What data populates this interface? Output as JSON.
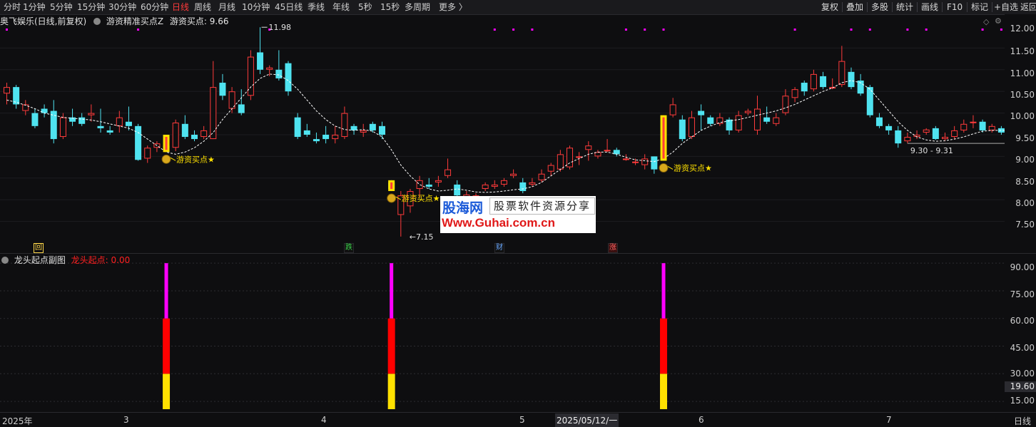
{
  "toolbar": {
    "periods": [
      "分时",
      "1分钟",
      "5分钟",
      "15分钟",
      "30分钟",
      "60分钟",
      "日线",
      "周线",
      "月线",
      "10分钟",
      "45日线",
      "季线",
      "年线",
      "5秒",
      "15秒",
      "多周期",
      "更多 〉"
    ],
    "active_period": "日线",
    "right_tools": [
      "复权",
      "叠加",
      "多股",
      "统计",
      "画线",
      "F10",
      "标记",
      "+自选",
      "返回"
    ]
  },
  "main_legend": {
    "stock": "奥飞娱乐(日线,前复权)",
    "indicator_name": "游资精准买点Z",
    "indicator_value": "游资买点: 9.66"
  },
  "sub_legend": {
    "indicator_name": "龙头起点副图",
    "indicator_value": "龙头起点: 0.00"
  },
  "price_axis": [
    "12.00",
    "11.50",
    "11.00",
    "10.50",
    "10.00",
    "9.50",
    "9.00",
    "8.50",
    "8.00",
    "7.50"
  ],
  "sub_axis": [
    "90.00",
    "75.00",
    "60.00",
    "45.00",
    "30.00",
    "15.00"
  ],
  "sub_axis_current": "19.60",
  "annotations": {
    "high": "11.98",
    "low": "7.15",
    "range": "9.30 - 9.31",
    "buy_signal": "游资买点★"
  },
  "markers": {
    "m1": "回",
    "m2": "跌",
    "m3": "财",
    "m4": "涨"
  },
  "watermark": {
    "title": "股海网",
    "subtitle": "股票软件资源分享",
    "url": "Www.Guhai.com.cn"
  },
  "date_axis": {
    "year": "2025年",
    "m3": "3",
    "m4": "4",
    "m5": "5",
    "cursor_date": "2025/05/12/一",
    "m6": "6",
    "m7": "7",
    "cycle": "日线"
  },
  "colors": {
    "up": "#ff3b3b",
    "down": "#4fe3f0",
    "ma": "#ffffff",
    "signal": "#ffe100",
    "magenta": "#ff00ff"
  },
  "chart_data": {
    "type": "candlestick",
    "price_range": [
      7.2,
      12.2
    ],
    "candles": [
      [
        10.45,
        10.6,
        10.7,
        10.2
      ],
      [
        10.6,
        10.2,
        10.65,
        10.1
      ],
      [
        10.05,
        10.2,
        10.3,
        9.95
      ],
      [
        10.0,
        9.7,
        10.1,
        9.65
      ],
      [
        10.1,
        10.0,
        10.2,
        9.9
      ],
      [
        10.05,
        9.4,
        10.3,
        9.3
      ],
      [
        9.45,
        9.9,
        10.0,
        9.4
      ],
      [
        9.9,
        9.8,
        10.1,
        9.7
      ],
      [
        9.9,
        9.75,
        10.0,
        9.7
      ],
      [
        9.95,
        10.0,
        10.2,
        9.8
      ],
      [
        9.7,
        9.65,
        10.1,
        9.55
      ],
      [
        9.6,
        9.55,
        9.7,
        9.5
      ],
      [
        9.7,
        9.9,
        10.05,
        9.55
      ],
      [
        9.8,
        9.7,
        10.15,
        9.6
      ],
      [
        9.7,
        8.92,
        9.75,
        8.9
      ],
      [
        8.95,
        9.2,
        9.25,
        8.85
      ],
      [
        9.2,
        9.3,
        9.35,
        9.1
      ],
      [
        9.25,
        9.2,
        9.5,
        9.1
      ],
      [
        9.2,
        9.78,
        9.85,
        9.12
      ],
      [
        9.75,
        9.45,
        9.95,
        9.4
      ],
      [
        9.5,
        9.4,
        9.6,
        9.35
      ],
      [
        9.45,
        9.6,
        9.7,
        9.4
      ],
      [
        9.4,
        10.6,
        11.2,
        9.4
      ],
      [
        10.7,
        10.4,
        10.9,
        10.3
      ],
      [
        10.1,
        10.5,
        10.6,
        10.0
      ],
      [
        10.2,
        10.0,
        10.55,
        9.95
      ],
      [
        10.4,
        11.3,
        11.45,
        10.3
      ],
      [
        11.4,
        11.0,
        11.98,
        10.9
      ],
      [
        11.0,
        11.05,
        11.1,
        10.85
      ],
      [
        11.0,
        10.8,
        11.45,
        10.75
      ],
      [
        11.15,
        10.5,
        11.2,
        10.4
      ],
      [
        9.9,
        9.45,
        10.0,
        9.4
      ],
      [
        9.6,
        9.5,
        9.75,
        9.45
      ],
      [
        9.4,
        9.35,
        9.55,
        9.3
      ],
      [
        9.5,
        9.4,
        9.7,
        9.3
      ],
      [
        9.4,
        9.5,
        9.7,
        9.3
      ],
      [
        9.45,
        10.0,
        10.15,
        9.4
      ],
      [
        9.7,
        9.6,
        9.75,
        9.5
      ],
      [
        9.55,
        9.6,
        9.75,
        9.45
      ],
      [
        9.75,
        9.6,
        9.8,
        9.55
      ],
      [
        9.7,
        9.5,
        9.8,
        9.4
      ],
      [
        8.4,
        8.25,
        8.45,
        8.2
      ],
      [
        7.65,
        8.1,
        8.2,
        7.15
      ],
      [
        7.85,
        8.2,
        8.25,
        7.7
      ],
      [
        8.25,
        8.45,
        8.55,
        8.05
      ],
      [
        8.35,
        8.3,
        8.5,
        8.25
      ],
      [
        8.4,
        8.45,
        8.55,
        8.3
      ],
      [
        8.55,
        8.7,
        8.95,
        8.5
      ],
      [
        8.35,
        8.1,
        8.45,
        8.05
      ],
      [
        8.0,
        8.12,
        8.2,
        7.95
      ],
      [
        8.05,
        8.1,
        8.15,
        8.0
      ],
      [
        8.25,
        8.35,
        8.4,
        8.2
      ],
      [
        8.3,
        8.35,
        8.45,
        8.25
      ],
      [
        8.35,
        8.45,
        8.5,
        8.3
      ],
      [
        8.55,
        8.6,
        8.7,
        8.5
      ],
      [
        8.4,
        8.2,
        8.5,
        8.15
      ],
      [
        8.35,
        8.4,
        8.5,
        8.3
      ],
      [
        8.45,
        8.6,
        8.7,
        8.4
      ],
      [
        8.65,
        8.8,
        8.85,
        8.55
      ],
      [
        8.7,
        9.05,
        9.15,
        8.65
      ],
      [
        8.75,
        9.2,
        9.25,
        8.7
      ],
      [
        9.0,
        9.0,
        9.1,
        8.8
      ],
      [
        9.15,
        9.25,
        9.35,
        8.9
      ],
      [
        9.0,
        9.1,
        9.15,
        8.95
      ],
      [
        9.15,
        9.15,
        9.4,
        9.1
      ],
      [
        9.15,
        9.05,
        9.2,
        9.0
      ],
      [
        8.95,
        8.95,
        9.05,
        8.9
      ],
      [
        8.85,
        8.88,
        8.95,
        8.8
      ],
      [
        8.8,
        8.95,
        9.05,
        8.7
      ],
      [
        9.0,
        8.7,
        9.0,
        8.6
      ],
      [
        8.95,
        9.9,
        9.95,
        8.9
      ],
      [
        9.95,
        10.2,
        10.35,
        9.9
      ],
      [
        9.85,
        9.4,
        9.95,
        9.35
      ],
      [
        9.45,
        9.9,
        10.05,
        9.4
      ],
      [
        10.05,
        9.95,
        10.2,
        9.6
      ],
      [
        9.9,
        9.75,
        9.95,
        9.7
      ],
      [
        9.75,
        9.9,
        10.0,
        9.7
      ],
      [
        9.85,
        9.6,
        9.9,
        9.5
      ],
      [
        9.6,
        9.95,
        10.05,
        9.55
      ],
      [
        10.0,
        10.05,
        10.1,
        9.95
      ],
      [
        9.6,
        10.1,
        10.4,
        9.5
      ],
      [
        9.9,
        9.8,
        10.15,
        9.75
      ],
      [
        9.75,
        9.9,
        10.0,
        9.7
      ],
      [
        10.0,
        10.4,
        10.55,
        9.95
      ],
      [
        10.35,
        10.55,
        10.6,
        10.25
      ],
      [
        10.7,
        10.5,
        10.75,
        10.4
      ],
      [
        10.55,
        10.9,
        11.0,
        10.5
      ],
      [
        10.85,
        10.6,
        10.95,
        10.55
      ],
      [
        10.6,
        10.6,
        10.8,
        10.55
      ],
      [
        10.65,
        11.2,
        11.55,
        10.6
      ],
      [
        10.95,
        10.6,
        11.05,
        10.55
      ],
      [
        10.75,
        10.45,
        10.9,
        10.4
      ],
      [
        10.6,
        9.95,
        10.65,
        9.9
      ],
      [
        9.9,
        9.7,
        10.0,
        9.65
      ],
      [
        9.7,
        9.6,
        9.75,
        9.5
      ],
      [
        9.6,
        9.3,
        9.7,
        9.2
      ],
      [
        9.35,
        9.45,
        9.55,
        9.3
      ],
      [
        9.45,
        9.5,
        9.6,
        9.4
      ],
      [
        9.55,
        9.62,
        9.65,
        9.5
      ],
      [
        9.65,
        9.4,
        9.7,
        9.38
      ],
      [
        9.4,
        9.45,
        9.55,
        9.35
      ],
      [
        9.45,
        9.6,
        9.7,
        9.4
      ],
      [
        9.6,
        9.75,
        9.85,
        9.55
      ],
      [
        9.8,
        9.8,
        9.95,
        9.65
      ],
      [
        9.8,
        9.6,
        9.85,
        9.55
      ],
      [
        9.6,
        9.7,
        9.75,
        9.55
      ],
      [
        9.65,
        9.55,
        9.7,
        9.5
      ],
      [
        9.6,
        9.65,
        9.75,
        9.55
      ],
      [
        9.65,
        9.5,
        9.7,
        9.45
      ],
      [
        9.5,
        9.65,
        9.7,
        9.45
      ],
      [
        9.6,
        9.55,
        9.7,
        9.5
      ],
      [
        9.55,
        9.65,
        9.75,
        9.5
      ],
      [
        9.65,
        9.75,
        9.8,
        9.6
      ]
    ],
    "ma": [
      10.3,
      10.25,
      10.18,
      10.1,
      10.0,
      9.95,
      9.9,
      9.88,
      9.86,
      9.84,
      9.8,
      9.75,
      9.7,
      9.65,
      9.55,
      9.4,
      9.25,
      9.1,
      9.05,
      9.1,
      9.2,
      9.35,
      9.55,
      9.85,
      10.1,
      10.35,
      10.6,
      10.8,
      10.9,
      10.88,
      10.75,
      10.55,
      10.3,
      10.05,
      9.85,
      9.7,
      9.62,
      9.6,
      9.62,
      9.58,
      9.45,
      9.15,
      8.8,
      8.55,
      8.35,
      8.25,
      8.2,
      8.22,
      8.25,
      8.22,
      8.18,
      8.17,
      8.18,
      8.2,
      8.23,
      8.25,
      8.3,
      8.4,
      8.55,
      8.7,
      8.85,
      8.95,
      9.05,
      9.1,
      9.1,
      9.05,
      8.98,
      8.92,
      8.9,
      8.88,
      8.95,
      9.1,
      9.3,
      9.45,
      9.6,
      9.7,
      9.78,
      9.82,
      9.85,
      9.9,
      9.95,
      10.0,
      10.05,
      10.12,
      10.2,
      10.3,
      10.4,
      10.5,
      10.58,
      10.7,
      10.75,
      10.7,
      10.55,
      10.3,
      10.05,
      9.8,
      9.6,
      9.45,
      9.38,
      9.35,
      9.36,
      9.4,
      9.45,
      9.52,
      9.58,
      9.6,
      9.6,
      9.6,
      9.58,
      9.57,
      9.58,
      9.6,
      9.62
    ],
    "magenta_marks_top": [
      0,
      2,
      4,
      6,
      8,
      12,
      14,
      16,
      18,
      20,
      22,
      24,
      26,
      28,
      30,
      32,
      34,
      36,
      38,
      40,
      44,
      46,
      48,
      50,
      52,
      54,
      56,
      58,
      60,
      62,
      64,
      66,
      68,
      70,
      72,
      74,
      76,
      78,
      80,
      82,
      84,
      86,
      88,
      90,
      92,
      94,
      96,
      98,
      100,
      102,
      104,
      106,
      108,
      110,
      112
    ],
    "signals": [
      {
        "index": 17,
        "price": 9.1
      },
      {
        "index": 41,
        "price": 7.35
      },
      {
        "index": 70,
        "price": 8.7
      }
    ],
    "sub_bars": [
      {
        "index": 17,
        "yellow": 30,
        "red": 60,
        "magenta": 90
      },
      {
        "index": 41,
        "yellow": 30,
        "red": 60,
        "magenta": 90
      },
      {
        "index": 70,
        "yellow": 30,
        "red": 60,
        "magenta": 90
      }
    ],
    "sub_range": [
      10,
      92
    ]
  }
}
